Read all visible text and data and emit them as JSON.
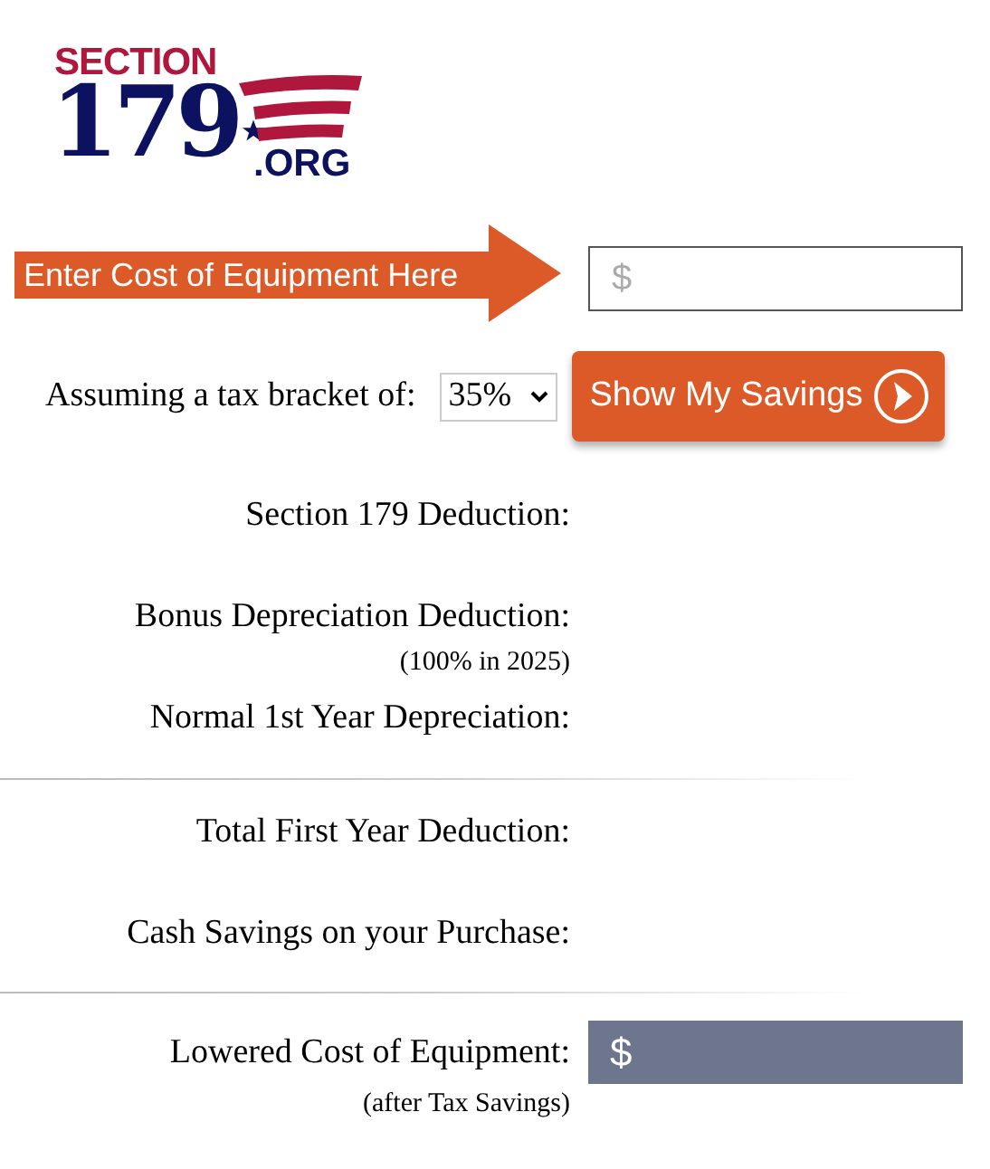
{
  "logo": {
    "word": "SECTION",
    "number": "179",
    "domain": ".ORG"
  },
  "cost_input": {
    "callout": "Enter Cost of Equipment Here",
    "placeholder": "$"
  },
  "tax_bracket": {
    "label": "Assuming a tax bracket of:",
    "value": "35%"
  },
  "submit_button": "Show My Savings",
  "result_groups": [
    [
      {
        "kind": "plain",
        "label": "Section 179 Deduction:"
      },
      {
        "kind": "plain",
        "label": "Bonus Depreciation Deduction:",
        "note": "(100% in 2025)"
      },
      {
        "kind": "plain",
        "label": "Normal 1st Year Depreciation:"
      }
    ],
    [
      {
        "kind": "plain",
        "label": "Total First Year Deduction:"
      },
      {
        "kind": "plain",
        "label": "Cash Savings on your Purchase:"
      }
    ],
    [
      {
        "kind": "highlight",
        "label": "Lowered Cost of Equipment:",
        "note": "(after Tax Savings)",
        "value": "$"
      }
    ]
  ]
}
